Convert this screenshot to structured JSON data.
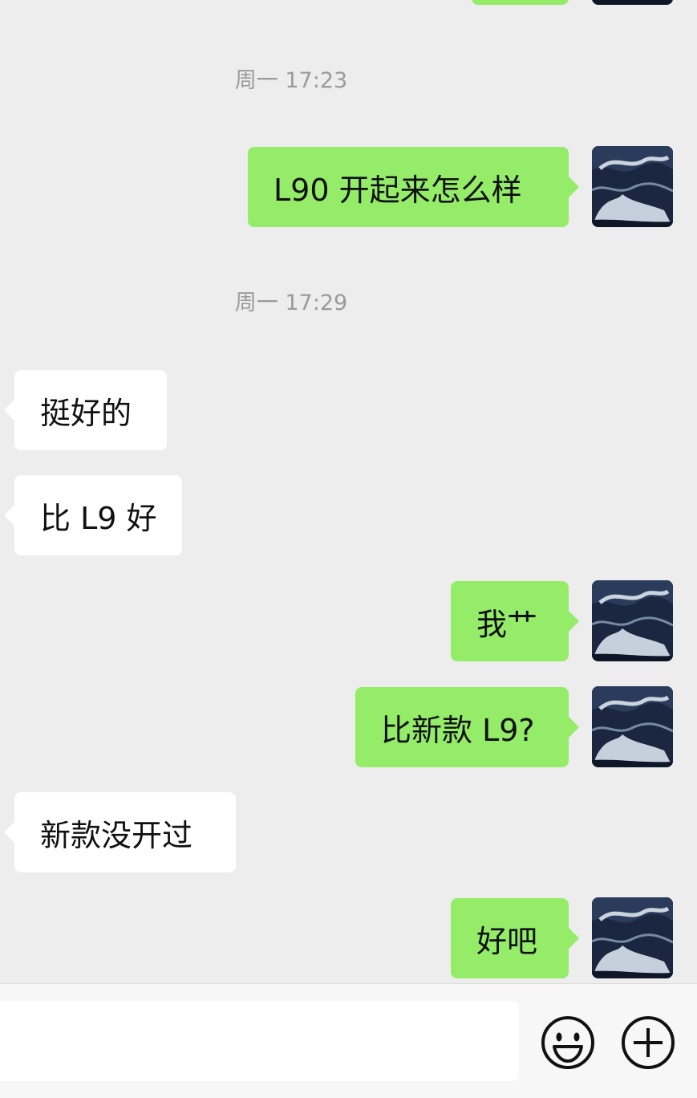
{
  "conversation": {
    "timestamps": [
      "周一 17:23",
      "周一 17:29"
    ],
    "messages": [
      {
        "side": "out",
        "text": "L90 开起来怎么样"
      },
      {
        "side": "in",
        "text": "挺好的"
      },
      {
        "side": "in",
        "text": "比 L9 好"
      },
      {
        "side": "out",
        "text": "我艹"
      },
      {
        "side": "out",
        "text": "比新款 L9?"
      },
      {
        "side": "in",
        "text": "新款没开过"
      },
      {
        "side": "out",
        "text": "好吧"
      }
    ]
  },
  "input_bar": {
    "text_value": "",
    "icons": [
      "emoji-icon",
      "plus-icon"
    ]
  },
  "colors": {
    "background": "#ededed",
    "outgoing_bubble": "#95ec69",
    "incoming_bubble": "#ffffff",
    "timestamp_text": "#9a9a9a"
  }
}
